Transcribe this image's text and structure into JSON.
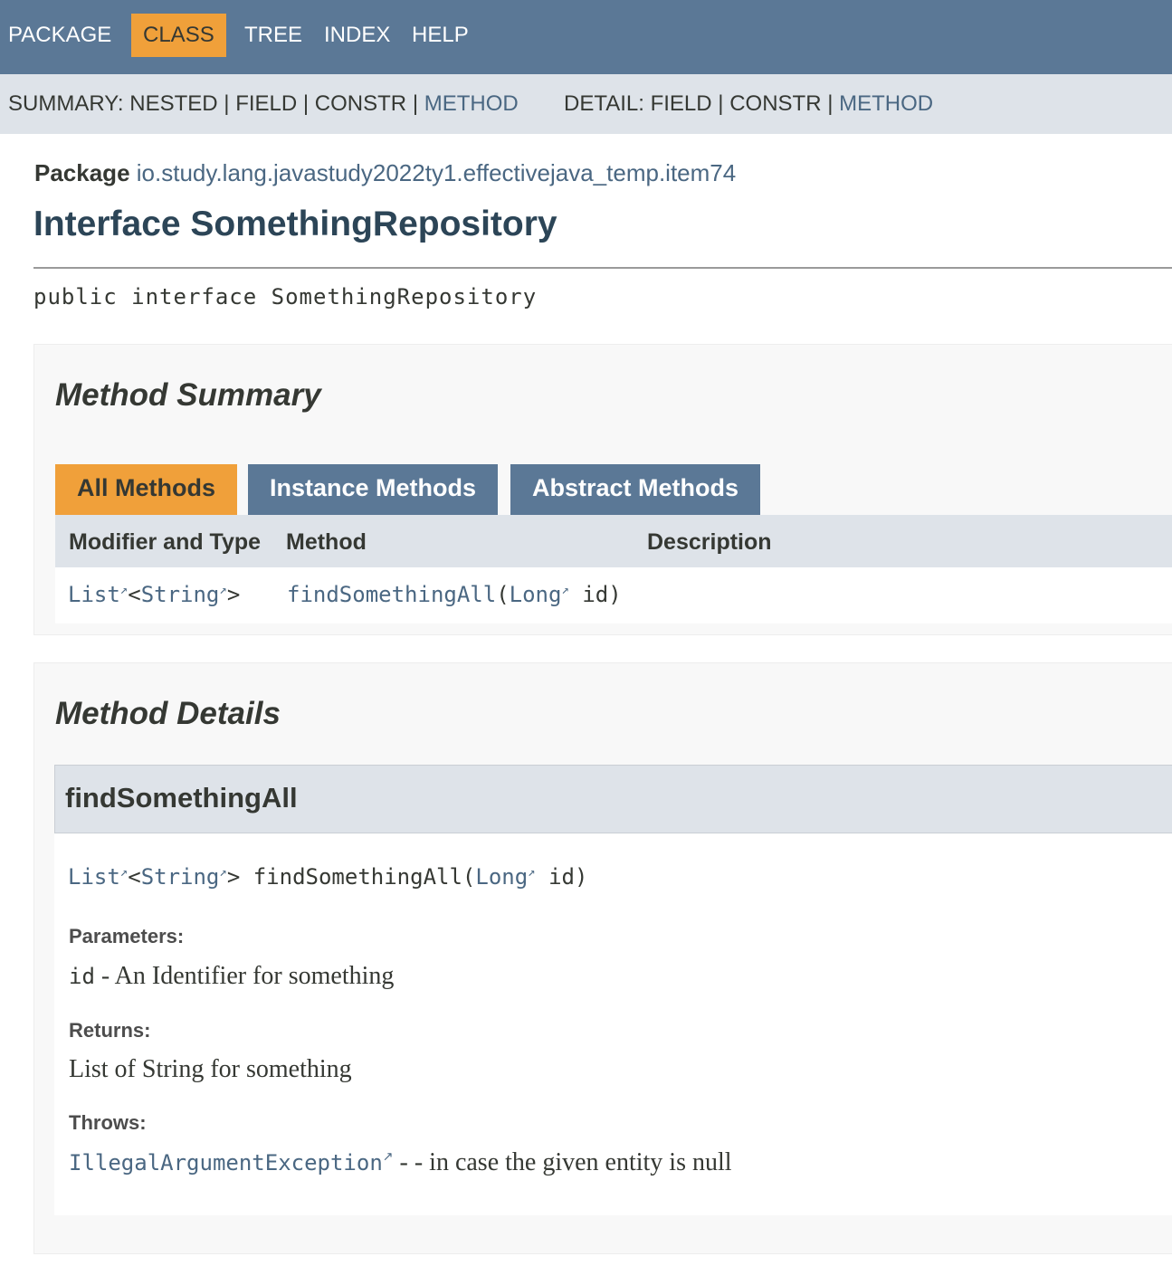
{
  "topnav": {
    "items": [
      "PACKAGE",
      "CLASS",
      "TREE",
      "INDEX",
      "HELP"
    ],
    "active": "CLASS"
  },
  "subnav": {
    "summary_label": "SUMMARY:",
    "summary_nested": "NESTED",
    "summary_field": "FIELD",
    "summary_constr": "CONSTR",
    "summary_method": "METHOD",
    "detail_label": "DETAIL:",
    "detail_field": "FIELD",
    "detail_constr": "CONSTR",
    "detail_method": "METHOD",
    "separator": "|"
  },
  "header": {
    "package_label": "Package",
    "package_name": "io.study.lang.javastudy2022ty1.effectivejava_temp.item74",
    "title": "Interface SomethingRepository"
  },
  "declaration": {
    "modifiers": "public interface",
    "name": "SomethingRepository"
  },
  "method_summary": {
    "title": "Method Summary",
    "tabs": [
      "All Methods",
      "Instance Methods",
      "Abstract Methods"
    ],
    "active_tab": "All Methods",
    "columns": [
      "Modifier and Type",
      "Method",
      "Description"
    ],
    "rows": [
      {
        "type_list": "List",
        "type_lt": "<",
        "type_string": "String",
        "type_gt": ">",
        "method_name": "findSomethingAll",
        "paren_open": "(",
        "param_type": "Long",
        "param_name": "id)",
        "description": ""
      }
    ]
  },
  "method_details": {
    "title": "Method Details",
    "method_name": "findSomethingAll",
    "signature": {
      "ret_list": "List",
      "lt": "<",
      "ret_string": "String",
      "gt_name": "> findSomethingAll(",
      "param_type": "Long",
      "param_name": "id)"
    },
    "parameters_label": "Parameters:",
    "param_code": "id",
    "param_desc": " - An Identifier for something",
    "returns_label": "Returns:",
    "returns_text": "List of String for something",
    "throws_label": "Throws:",
    "throws_exception": "IllegalArgumentException",
    "throws_desc": " - - in case the given entity is null"
  },
  "icons": {
    "external_link": "external-link-icon"
  },
  "colors": {
    "nav_bg": "#5b7896",
    "accent": "#f0a03a",
    "subnav_bg": "#dee3e9",
    "link": "#4a6782"
  }
}
